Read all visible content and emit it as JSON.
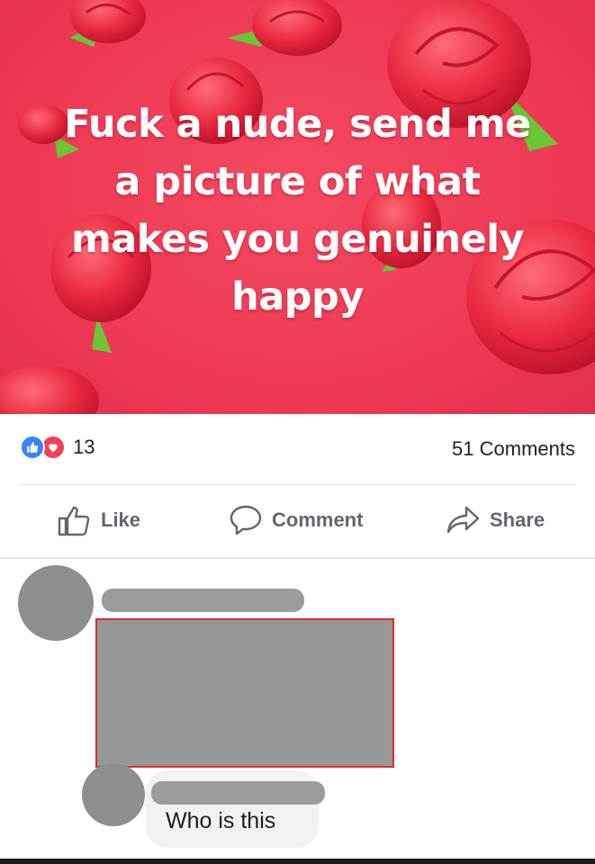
{
  "post": {
    "quote_lines": [
      "Fuck a nude, send me",
      "a picture of what",
      "makes you genuinely",
      "happy"
    ],
    "reaction_count": "13",
    "comments_label": "51 Comments"
  },
  "actions": {
    "like": "Like",
    "comment": "Comment",
    "share": "Share"
  },
  "reply": {
    "text": "Who is this"
  },
  "icons": [
    "like-reaction-icon",
    "love-reaction-icon",
    "thumbs-up-icon",
    "speech-bubble-icon",
    "share-arrow-icon",
    "avatar"
  ],
  "colors": {
    "background_red": "#ee3a55",
    "like_blue": "#3b82f6",
    "love_red": "#f0415a",
    "action_gray": "#606770",
    "redaction_border": "#e22b2b"
  }
}
